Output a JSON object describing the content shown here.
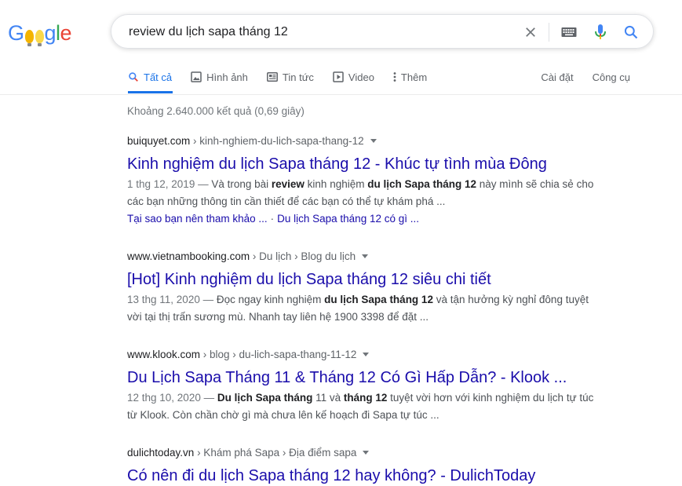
{
  "logo": {
    "text": "Google"
  },
  "search": {
    "query": "review du lịch sapa tháng 12"
  },
  "tabs": [
    {
      "label": "Tất cả",
      "icon": "search-icon"
    },
    {
      "label": "Hình ảnh",
      "icon": "image-icon"
    },
    {
      "label": "Tin tức",
      "icon": "news-icon"
    },
    {
      "label": "Video",
      "icon": "video-icon"
    },
    {
      "label": "Thêm",
      "icon": "more-icon"
    }
  ],
  "tools": {
    "settings": "Cài đặt",
    "tools": "Công cụ"
  },
  "stats": "Khoảng 2.640.000 kết quả (0,69 giây)",
  "results": [
    {
      "domain": "buiquyet.com",
      "path": " › kinh-nghiem-du-lich-sapa-thang-12",
      "title": "Kinh nghiệm du lịch Sapa tháng 12 - Khúc tự tình mùa Đông",
      "date": "1 thg 12, 2019 — ",
      "snippet_parts": [
        "Và trong bài ",
        "review",
        " kinh nghiệm ",
        "du lịch Sapa tháng 12",
        " này mình sẽ chia sẻ cho các bạn những thông tin cần thiết để các bạn có thể tự khám phá ..."
      ],
      "sitelinks": [
        "Tại sao bạn nên tham khảo ...",
        "Du lịch Sapa tháng 12 có gì ..."
      ]
    },
    {
      "domain": "www.vietnambooking.com",
      "path": " › Du lịch › Blog du lịch",
      "title": "[Hot] Kinh nghiệm du lịch Sapa tháng 12 siêu chi tiết",
      "date": "13 thg 11, 2020 — ",
      "snippet_parts": [
        "Đọc ngay kinh nghiệm ",
        "du lịch Sapa tháng 12",
        " và tận hưởng kỳ nghỉ đông tuyệt vời tại thị trấn sương mù. Nhanh tay liên hệ 1900 3398 để đặt ..."
      ]
    },
    {
      "domain": "www.klook.com",
      "path": " › blog › du-lich-sapa-thang-11-12",
      "title": "Du Lịch Sapa Tháng 11 & Tháng 12 Có Gì Hấp Dẫn? - Klook ...",
      "date": "12 thg 10, 2020 — ",
      "snippet_parts": [
        "",
        "Du lịch Sapa tháng",
        " 11 và ",
        "tháng 12",
        " tuyệt vời hơn với kinh nghiệm du lịch tự túc từ Klook. Còn chần chờ gì mà chưa lên kế hoạch đi Sapa tự túc ..."
      ]
    },
    {
      "domain": "dulichtoday.vn",
      "path": " › Khám phá Sapa › Địa điểm sapa",
      "title": "Có nên đi du lịch Sapa tháng 12 hay không? - DulichToday"
    }
  ],
  "colors": {
    "link": "#1a0dab",
    "accent": "#1a73e8",
    "text_muted": "#70757a"
  }
}
